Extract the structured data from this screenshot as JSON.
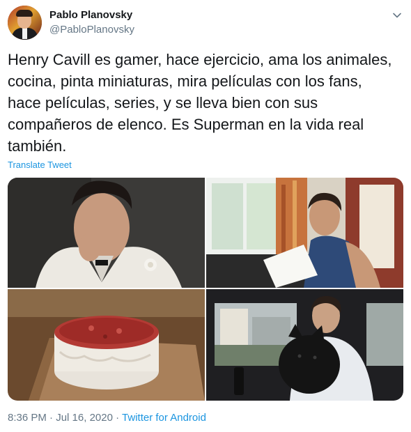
{
  "user": {
    "name": "Pablo Planovsky",
    "handle": "@PabloPlanovsky"
  },
  "tweet": {
    "text": "Henry Cavill es gamer, hace ejercicio, ama los animales,\ncocina, pinta miniaturas, mira películas con los fans,\nhace películas, series, y se lleva bien con sus\ncompañeros de elenco. Es Superman en la vida real\ntambién.",
    "translate_label": "Translate Tweet",
    "time": "8:36 PM",
    "separator": "·",
    "date": "Jul 16, 2020",
    "source": "Twitter for Android"
  },
  "media": {
    "photos": [
      {
        "subject": "man-in-white-tuxedo-photo"
      },
      {
        "subject": "man-reading-script-photo"
      },
      {
        "subject": "red-velvet-cake-photo"
      },
      {
        "subject": "man-with-dog-in-car-photo"
      }
    ]
  },
  "icons": {
    "caret": "chevron-down-icon"
  },
  "colors": {
    "text": "#14171a",
    "secondary": "#657786",
    "link": "#1b95e0"
  }
}
